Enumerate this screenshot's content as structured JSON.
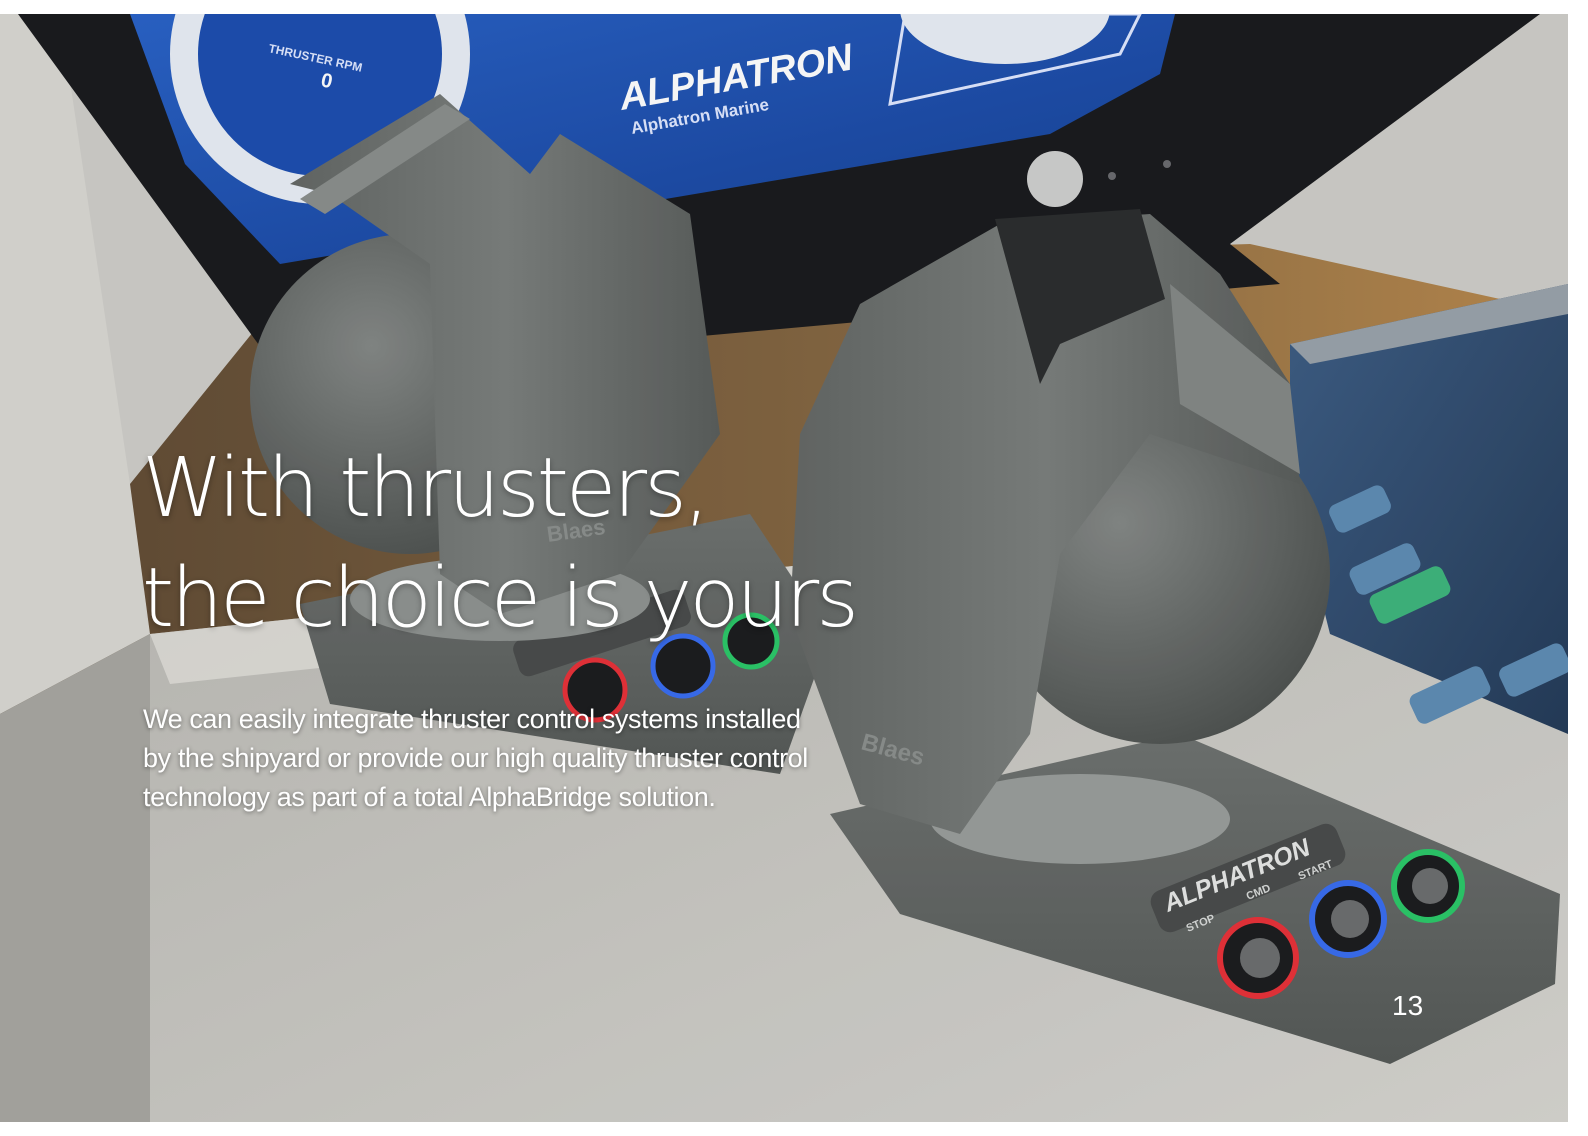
{
  "headline": {
    "line1": "With thrusters,",
    "line2": "the choice is yours"
  },
  "body": {
    "line1": "We can easily integrate thruster control systems installed",
    "line2": "by the shipyard or provide our high quality thruster control",
    "line3": "technology as part of a total AlphaBridge solution."
  },
  "page_number": "13",
  "screen": {
    "gauge_label": "THRUSTER RPM",
    "gauge_value": "0",
    "brand": "ALPHATRON",
    "brand_sub": "Alphatron Marine"
  },
  "panel": {
    "brand": "ALPHATRON",
    "button_labels": [
      "STOP",
      "CMD",
      "START"
    ]
  },
  "joystick_mark": "Blaes",
  "colors": {
    "screen_blue": "#1e4fb0",
    "body_gray": "#6e7270",
    "stop_ring": "#e8323a",
    "cmd_ring": "#3a6ef0",
    "start_ring": "#2cc86a"
  }
}
